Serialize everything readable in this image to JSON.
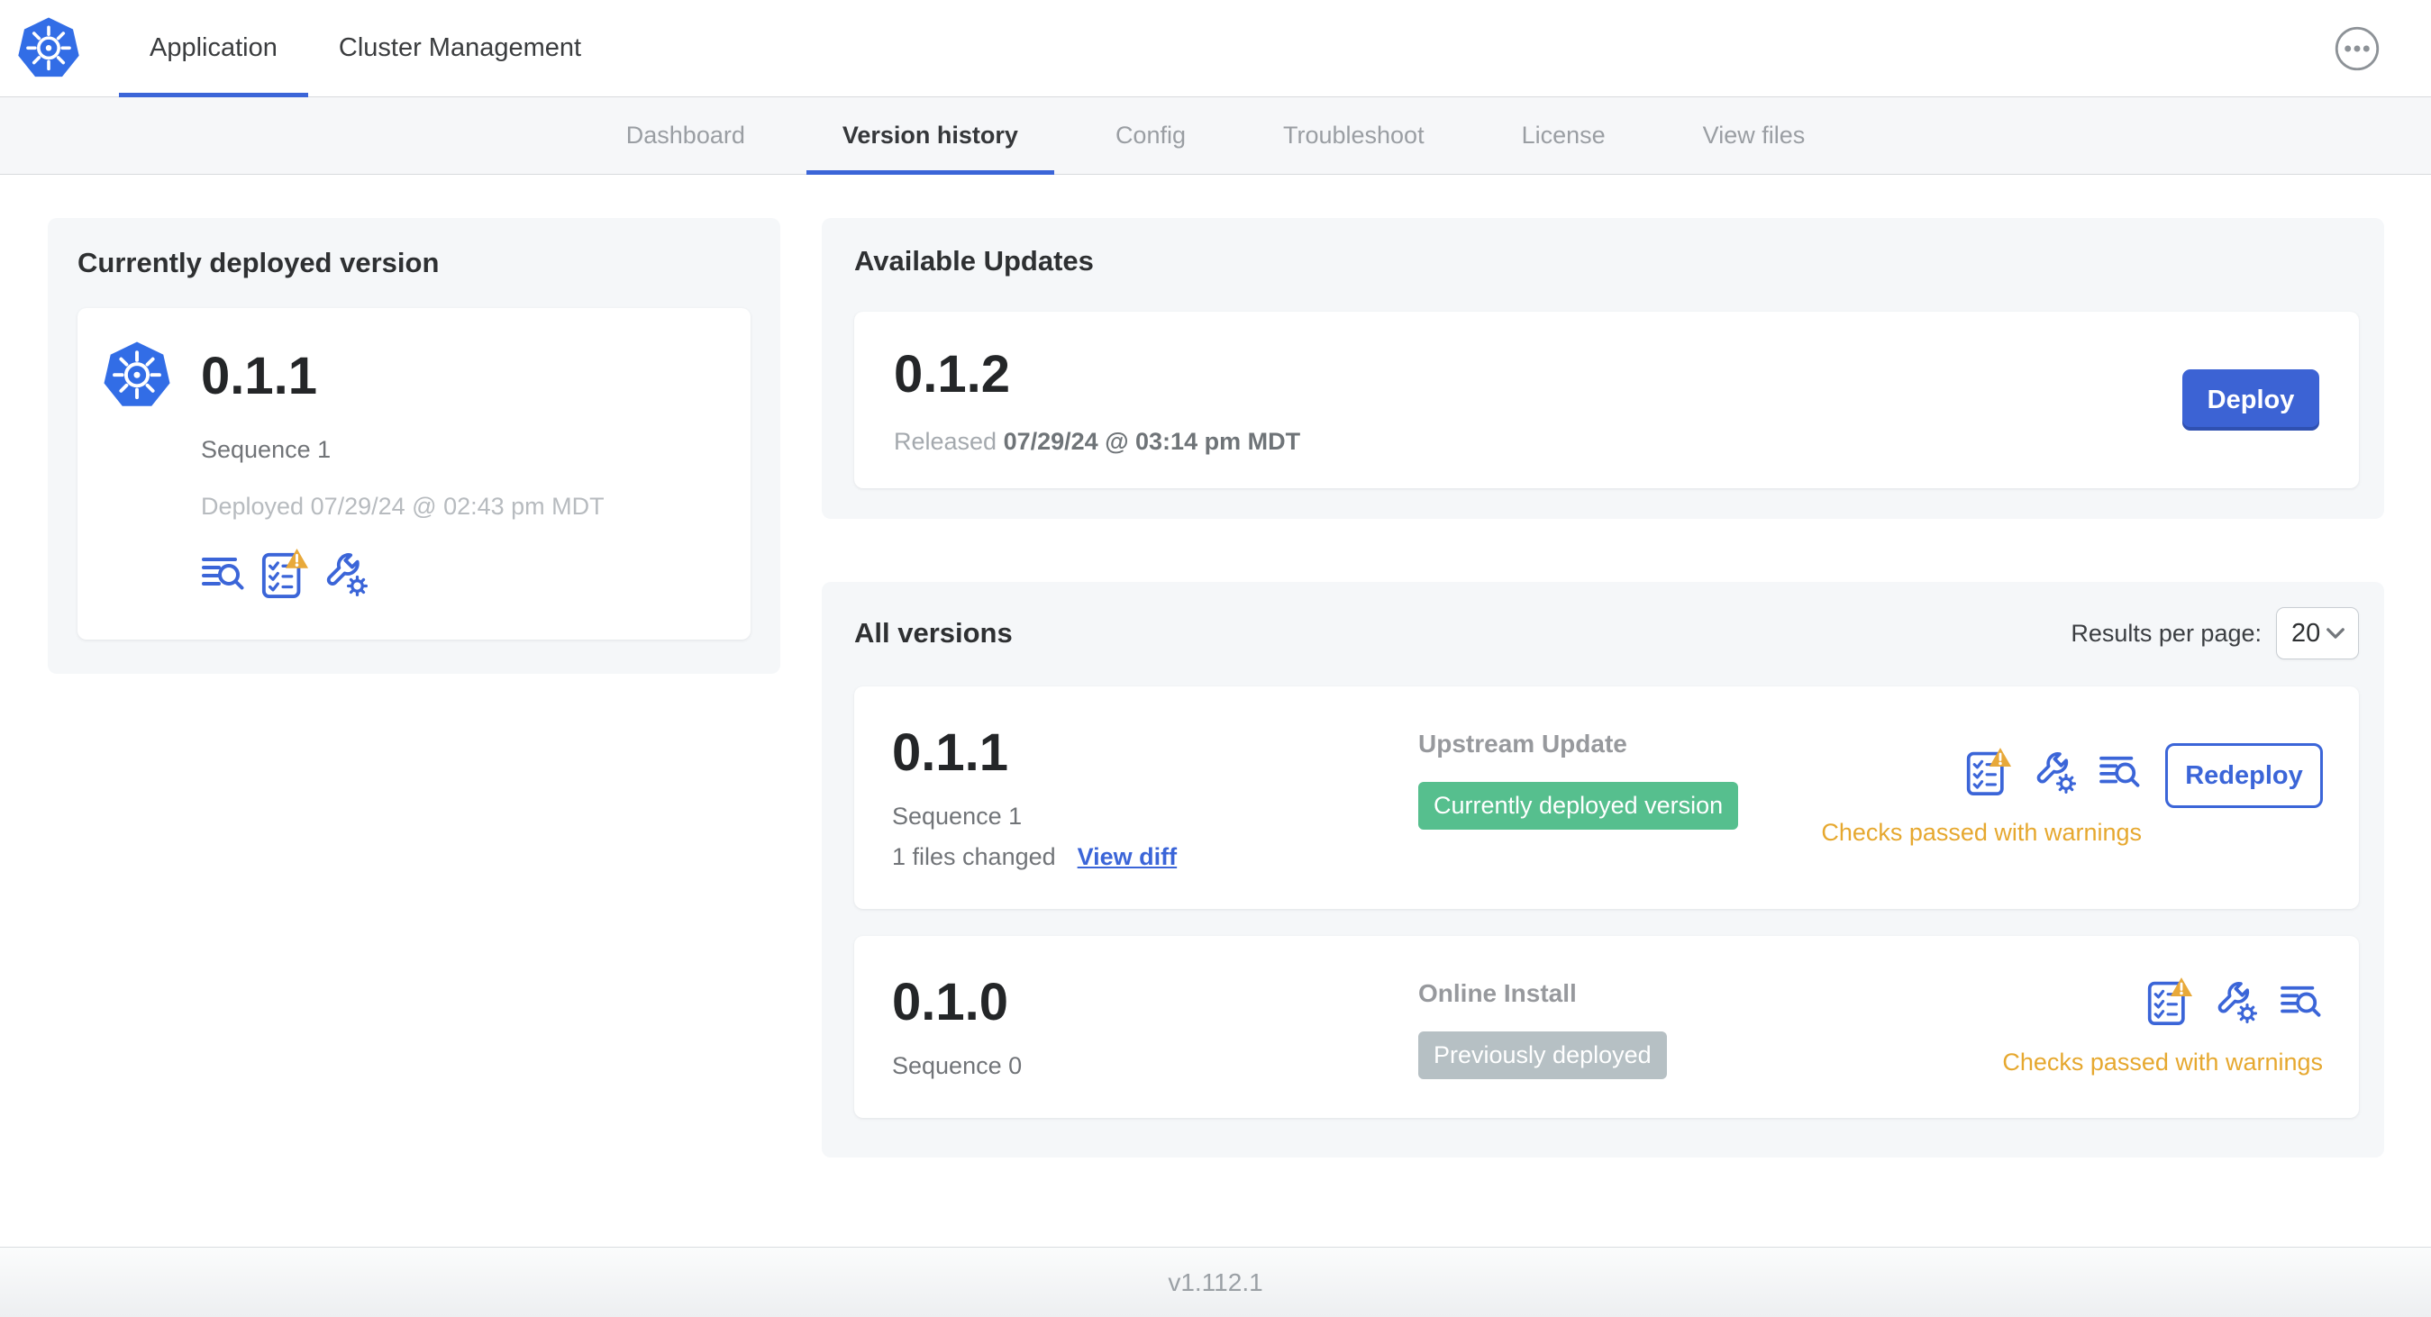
{
  "header": {
    "tabs": [
      {
        "label": "Application",
        "active": true
      },
      {
        "label": "Cluster Management",
        "active": false
      }
    ],
    "more_menu_icon": "ellipsis-circle"
  },
  "subnav": {
    "items": [
      "Dashboard",
      "Version history",
      "Config",
      "Troubleshoot",
      "License",
      "View files"
    ],
    "active_item": "Version history"
  },
  "currently_deployed": {
    "title": "Currently deployed version",
    "version": "0.1.1",
    "sequence": "Sequence 1",
    "deployed": "Deployed 07/29/24 @ 02:43 pm MDT",
    "icons": [
      "diff-lines-magnifier",
      "preflight-checklist-warning",
      "config-wrench-gear"
    ]
  },
  "available_updates": {
    "title": "Available Updates",
    "version": "0.1.2",
    "released_label": "Released",
    "released_date": "07/29/24 @ 03:14 pm MDT",
    "deploy_label": "Deploy"
  },
  "all_versions": {
    "title": "All versions",
    "results_per_page_label": "Results per page:",
    "results_per_page_value": "20",
    "rows": [
      {
        "version": "0.1.1",
        "sequence": "Sequence 1",
        "files_changed": "1 files changed",
        "view_diff": "View diff",
        "source": "Upstream Update",
        "badge": "Currently deployed version",
        "badge_color": "#56bf8e",
        "icons": [
          "preflight-checklist-warning",
          "config-wrench-gear",
          "diff-lines-magnifier"
        ],
        "checks": "Checks passed with warnings",
        "action": "Redeploy"
      },
      {
        "version": "0.1.0",
        "sequence": "Sequence 0",
        "source": "Online Install",
        "badge": "Previously deployed",
        "badge_color": "#b6c0c4",
        "icons": [
          "preflight-checklist-warning",
          "config-wrench-gear",
          "diff-lines-magnifier"
        ],
        "checks": "Checks passed with warnings"
      }
    ]
  },
  "footer": {
    "app_version": "v1.112.1"
  },
  "colors": {
    "accent_blue": "#3b65d8",
    "kubernetes_blue": "#326de6",
    "badge_green": "#56bf8e",
    "badge_gray": "#b6c0c4",
    "warning_orange": "#e6a82f"
  }
}
